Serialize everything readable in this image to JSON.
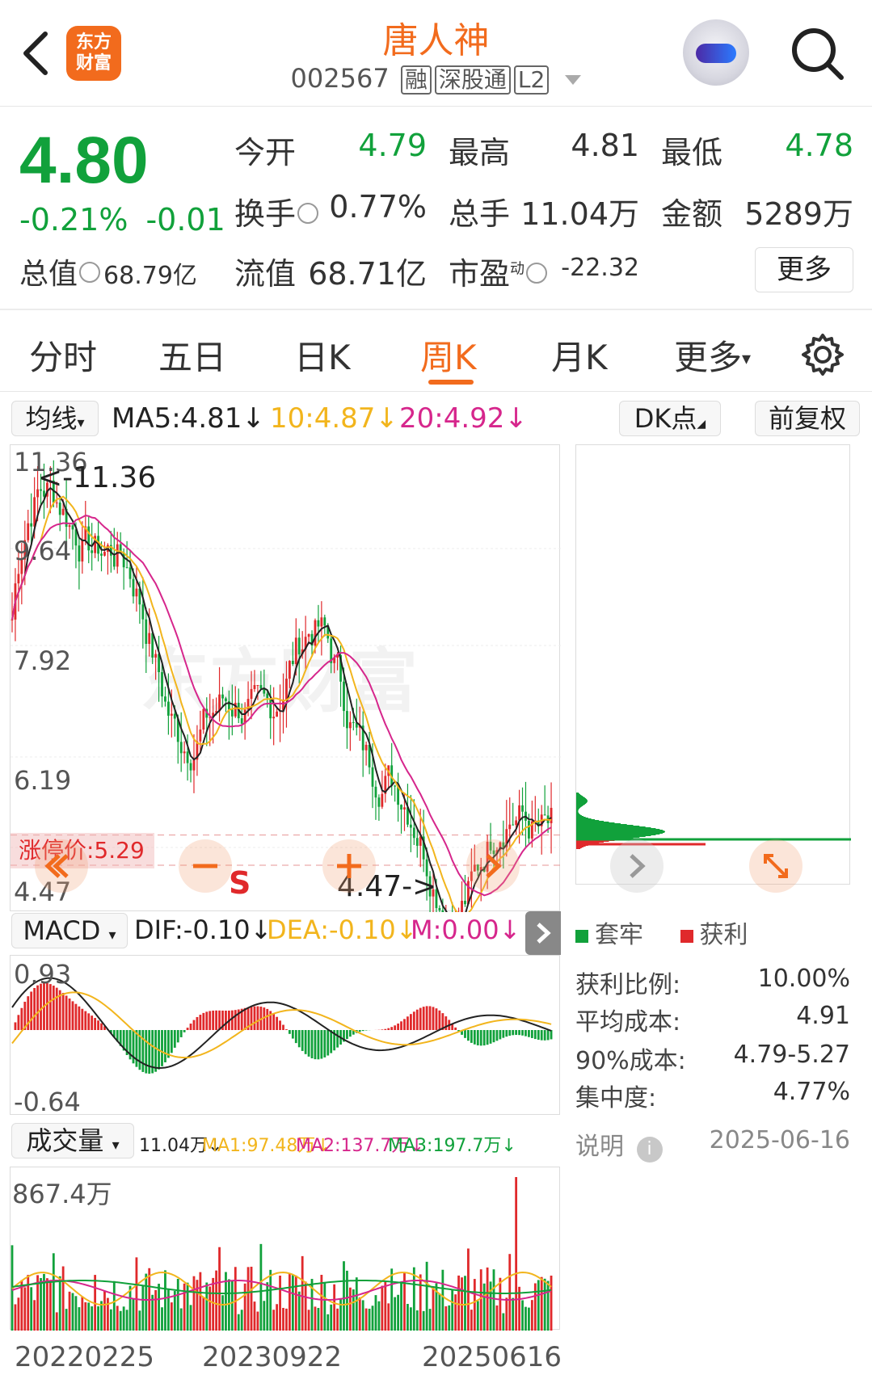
{
  "header": {
    "title": "唐人神",
    "code": "002567",
    "tags": [
      "融",
      "深股通",
      "L2"
    ],
    "logo_text": [
      "东方",
      "财富"
    ]
  },
  "quote": {
    "price": "4.80",
    "change_pct": "-0.21%",
    "change": "-0.01",
    "open_label": "今开",
    "open": "4.79",
    "high_label": "最高",
    "high": "4.81",
    "low_label": "最低",
    "low": "4.78",
    "turnover_label": "换手",
    "turnover": "0.77%",
    "volume_label": "总手",
    "volume": "11.04万",
    "amount_label": "金额",
    "amount": "5289万",
    "total_cap_label": "总值",
    "total_cap": "68.79亿",
    "float_cap_label": "流值",
    "float_cap": "68.71亿",
    "pe_label": "市盈",
    "pe_sup": "动",
    "pe": "-22.32",
    "more_label": "更多"
  },
  "tabs": [
    "分时",
    "五日",
    "日K",
    "周K",
    "月K",
    "更多"
  ],
  "active_tab": "周K",
  "ma": {
    "dropdown": "均线",
    "ma5": "MA5:4.81",
    "ma10": "10:4.87",
    "ma20": "20:4.92",
    "dk_label": "DK点",
    "fq_label": "前复权"
  },
  "kline": {
    "y_ticks": [
      "11.36",
      "9.64",
      "7.92",
      "6.19",
      "4.47"
    ],
    "max_annotation": "<-11.36",
    "min_annotation": "4.47->",
    "limit_up": "涨停价:5.29",
    "buy_mark": "S",
    "watermark": "东方财富"
  },
  "macd": {
    "dropdown": "MACD",
    "dif": "DIF:-0.10",
    "dea": "DEA:-0.10",
    "m": "M:0.00",
    "y_ticks": [
      "0.93",
      "-0.64"
    ]
  },
  "volume": {
    "dropdown": "成交量",
    "current": "11.04万",
    "ma1": "MA1:97.48万",
    "ma2": "MA2:137.7万",
    "ma3": "MA3:197.7万",
    "y_max": "867.4万"
  },
  "x_dates": [
    "20220225",
    "20230922",
    "20250616"
  ],
  "chip": {
    "legend_trap": "套牢",
    "legend_profit": "获利",
    "profit_ratio_label": "获利比例:",
    "profit_ratio": "10.00%",
    "avg_cost_label": "平均成本:",
    "avg_cost": "4.91",
    "cost90_label": "90%成本:",
    "cost90": "4.79-5.27",
    "concentration_label": "集中度:",
    "concentration": "4.77%",
    "note_label": "说明",
    "date": "2025-06-16"
  },
  "colors": {
    "up": "#e0292b",
    "down": "#11a13b",
    "accent": "#f26b1d",
    "ma10": "#f2b51d",
    "ma20": "#d6268c"
  }
}
